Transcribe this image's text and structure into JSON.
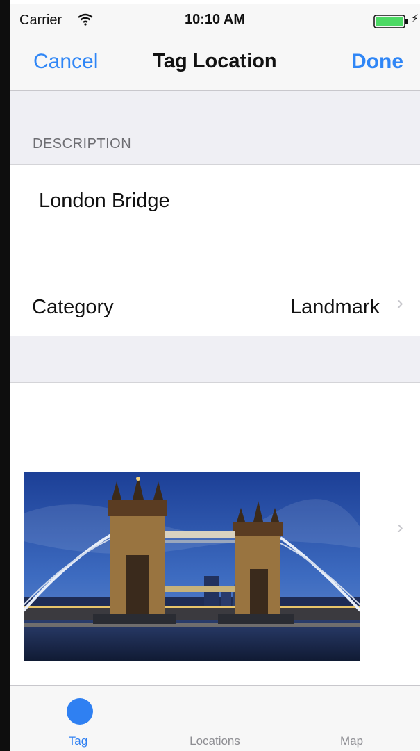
{
  "status_bar": {
    "carrier": "Carrier",
    "time": "10:10 AM",
    "wifi_icon": "wifi-icon",
    "battery_icon": "battery-icon",
    "battery_level": 1.0,
    "battery_color": "#4cd964",
    "charging_symbol": "⚡"
  },
  "nav": {
    "cancel_label": "Cancel",
    "title": "Tag Location",
    "done_label": "Done",
    "accent_color": "#2f86f6"
  },
  "description_section": {
    "header": "DESCRIPTION",
    "text": "London Bridge"
  },
  "category": {
    "label": "Category",
    "value": "Landmark",
    "chevron": "›"
  },
  "photo": {
    "chevron": "›"
  },
  "tabs": [
    {
      "label": "Tag",
      "icon": "tag-circle-icon",
      "selected": true,
      "color": "#2f80f2"
    },
    {
      "label": "Locations",
      "icon": "",
      "selected": false,
      "color": "#8e8e93"
    },
    {
      "label": "Map",
      "icon": "",
      "selected": false,
      "color": "#8e8e93"
    }
  ]
}
